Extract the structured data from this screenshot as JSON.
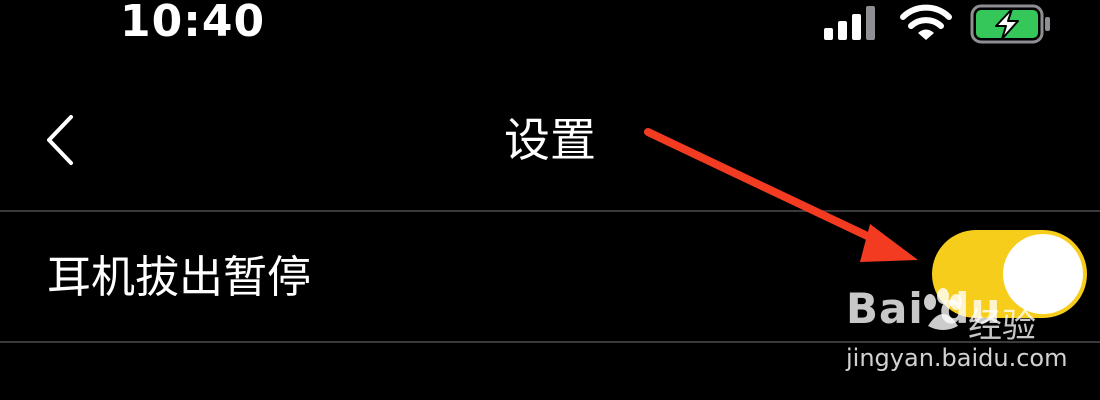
{
  "status_bar": {
    "time": "10:40",
    "icons": [
      "cellular-signal-icon",
      "wifi-icon",
      "battery-charging-icon"
    ],
    "battery_color": "#35c759"
  },
  "nav": {
    "back_icon": "chevron-left-icon",
    "title": "设置"
  },
  "settings": [
    {
      "label": "耳机拔出暂停",
      "toggle_on": true,
      "toggle_color": "#f7cd1b"
    }
  ],
  "annotation": {
    "arrow_color": "#f23b21"
  },
  "watermark": {
    "logo": "Bai du",
    "brand_cn": "经验",
    "url": "jingyan.baidu.com"
  }
}
